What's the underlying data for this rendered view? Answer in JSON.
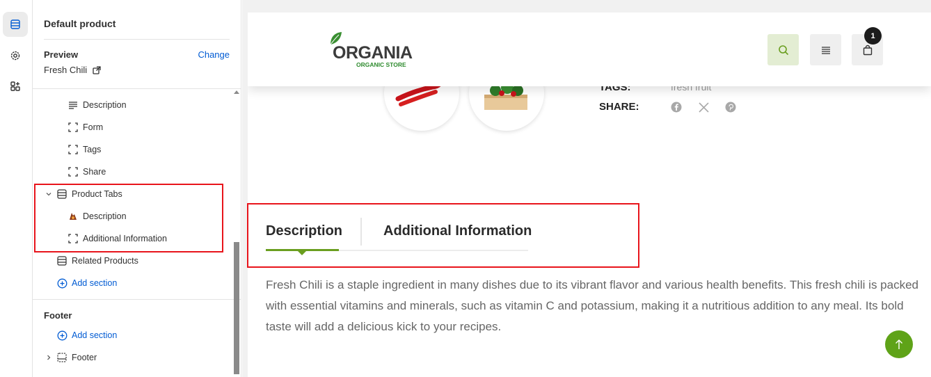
{
  "sidebar": {
    "title": "Default product",
    "preview_label": "Preview",
    "preview_change": "Change",
    "preview_value": "Fresh Chili",
    "tree": [
      {
        "label": "Description"
      },
      {
        "label": "Form"
      },
      {
        "label": "Tags"
      },
      {
        "label": "Share"
      },
      {
        "label": "Product Tabs"
      },
      {
        "label": "Description"
      },
      {
        "label": "Additional Information"
      },
      {
        "label": "Related Products"
      },
      {
        "label": "Add section"
      }
    ],
    "footer_group": "Footer",
    "footer_add": "Add section",
    "footer_item": "Footer"
  },
  "store": {
    "logo_main": "ORGANIA",
    "logo_sub": "ORGANIC STORE",
    "cart_count": "1",
    "accent": "#6a9e1f"
  },
  "product": {
    "tags_label": "TAGS:",
    "tags_value": "fresh fruit",
    "share_label": "SHARE:",
    "share_icons": [
      "facebook-icon",
      "x-icon",
      "pinterest-icon"
    ],
    "tabs": [
      {
        "label": "Description",
        "active": true
      },
      {
        "label": "Additional Information",
        "active": false
      }
    ],
    "description": "Fresh Chili is a staple ingredient in many dishes due to its vibrant flavor and various health benefits. This fresh chili is packed with essential vitamins and minerals, such as vitamin C and potassium, making it a nutritious addition to any meal. Its bold taste will add a delicious kick to your recipes."
  }
}
